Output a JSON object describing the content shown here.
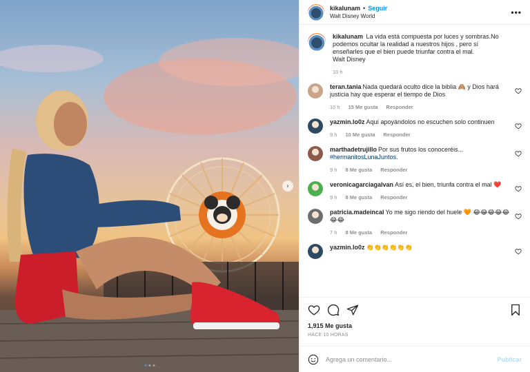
{
  "header": {
    "username": "kikalunam",
    "separator": "•",
    "follow_label": "Seguir",
    "location": "Walt Disney World",
    "more_icon": "more-horizontal-icon"
  },
  "caption": {
    "username": "kikalunam",
    "text": "La vida está compuesta por luces y sombras.No podemos ocultar la realidad a nuestros hijos , pero sí enseñarles que el bien puede triunfar contra el mal.",
    "signature": "Walt Disney",
    "time": "10 h"
  },
  "comments": [
    {
      "username": "teran.tania",
      "text": "Nada quedará oculto dice la biblia 🙈 y Dios hará justicia hay que esperar el tiempo de Dios",
      "time": "10 h",
      "likes": "15 Me gusta",
      "reply": "Responder",
      "avatar_color": "#c9a38a"
    },
    {
      "username": "yazmin.lo0z",
      "text": "Aquí apoyándolos no escuchen solo continuen",
      "time": "9 h",
      "likes": "10 Me gusta",
      "reply": "Responder",
      "avatar_color": "#2e4a63"
    },
    {
      "username": "marthadetrujillo",
      "text": "Por sus frutos los conoceréis...",
      "hashtag": "#hermanitosLunaJuntos.",
      "time": "9 h",
      "likes": "8 Me gusta",
      "reply": "Responder",
      "avatar_color": "#8a5a4a"
    },
    {
      "username": "veronicagarciagalvan",
      "text": "Así es, el bien, triunfa contra el mal ❤️",
      "time": "9 h",
      "likes": "8 Me gusta",
      "reply": "Responder",
      "avatar_color": "#4caf50"
    },
    {
      "username": "patricia.madeincal",
      "text": "Yo me sigo riendo del huele 🧡 😂😂😂😂😂😂😂",
      "time": "7 h",
      "likes": "8 Me gusta",
      "reply": "Responder",
      "avatar_color": "#6d6d6d"
    },
    {
      "username": "yazmin.lo0z",
      "text": "👏👏👏👏👏👏",
      "time": "",
      "likes": "",
      "reply": "",
      "avatar_color": "#2e4a63"
    }
  ],
  "actions": {
    "likes": "1,915 Me gusta",
    "time": "HACE 10 HORAS"
  },
  "add_comment": {
    "placeholder": "Agrega un comentario...",
    "publish": "Publicar"
  },
  "colors": {
    "accent": "#0095f6",
    "publish_disabled": "#b2dffc",
    "heart_red": "#ed4956"
  }
}
